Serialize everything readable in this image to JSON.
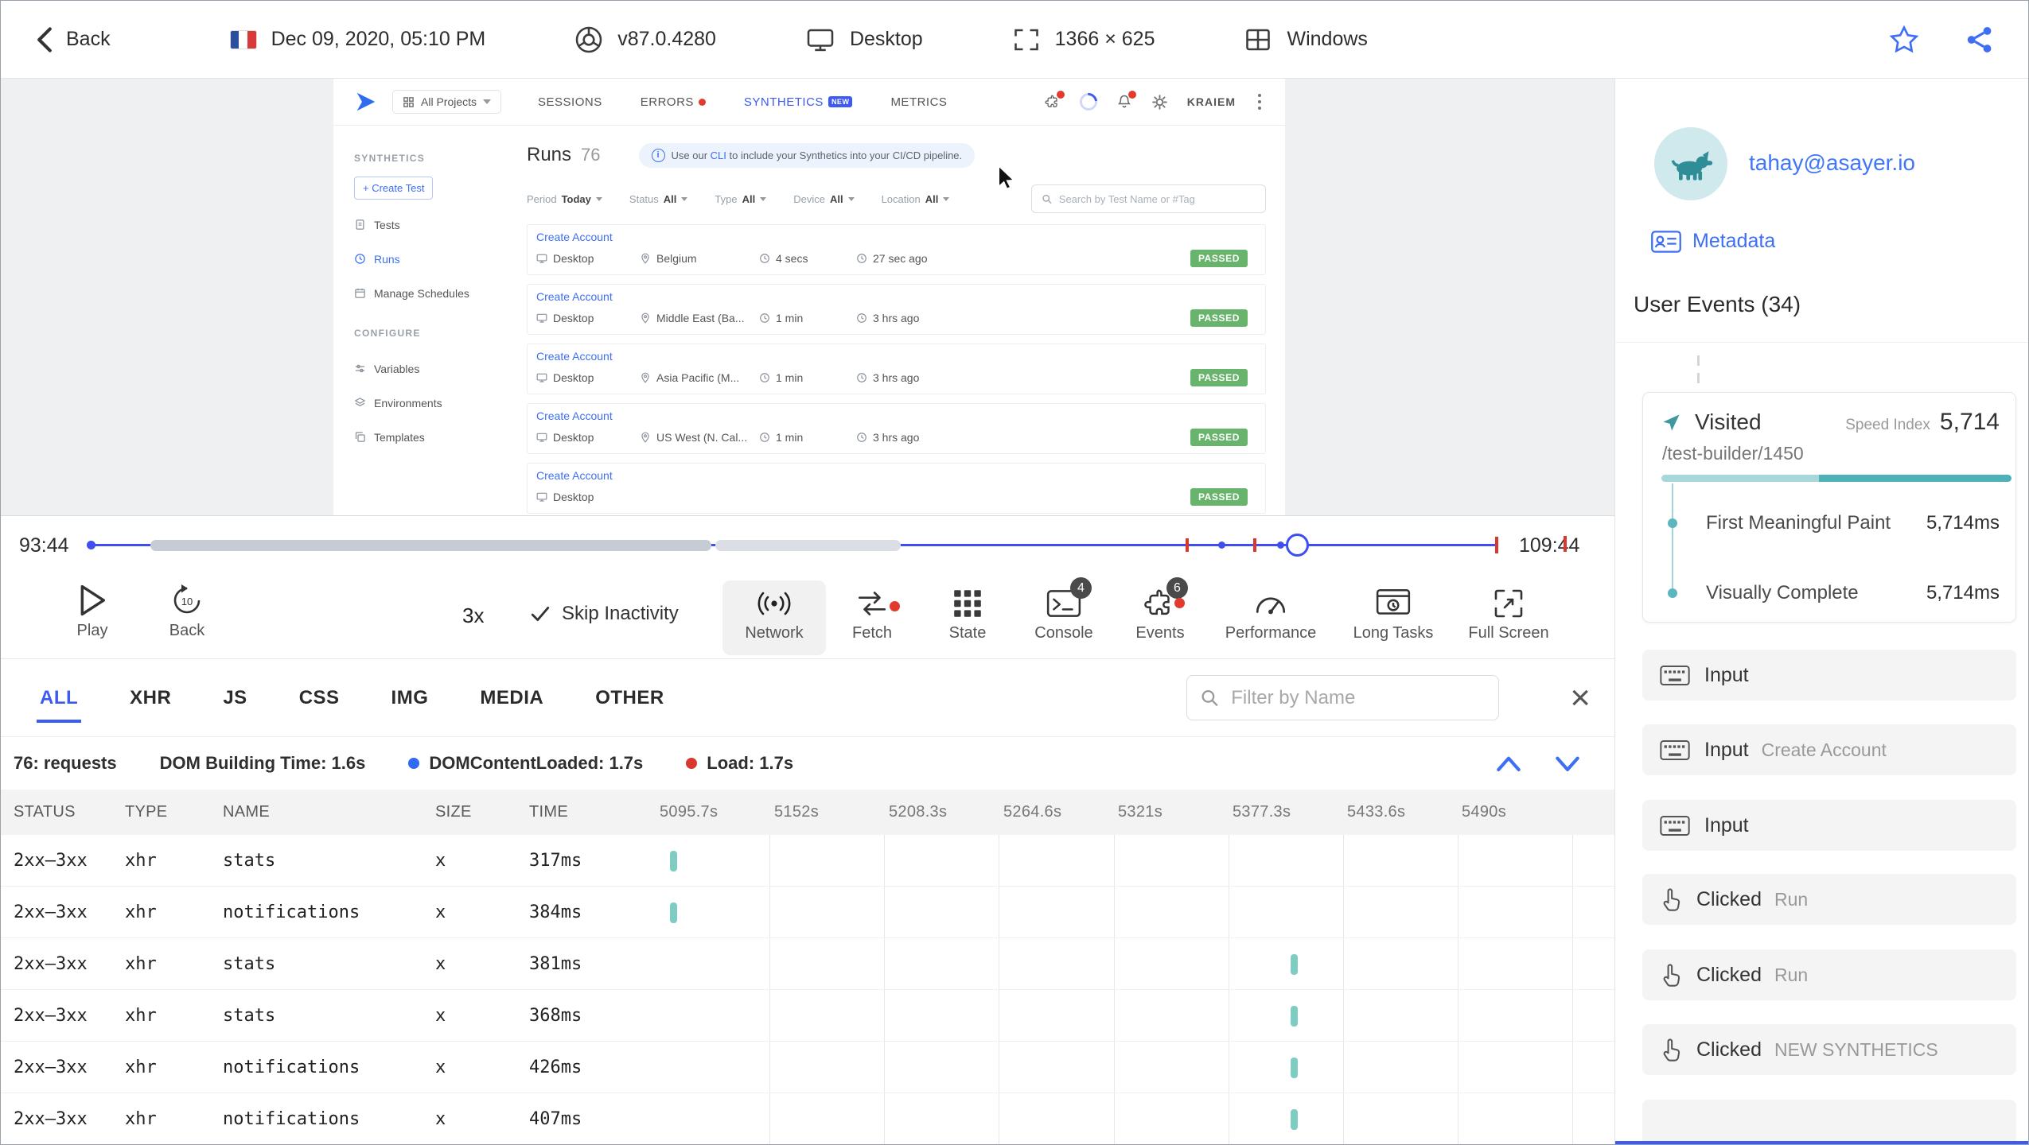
{
  "colors": {
    "accent_blue": "#3d5af1",
    "link_blue": "#3f6df6",
    "teal": "#3fa9ae",
    "passed_green": "#68b46c",
    "error_red": "#e23b2e"
  },
  "header": {
    "back_label": "Back",
    "date": "Dec 09, 2020, 05:10 PM",
    "browser_version": "v87.0.4280",
    "device": "Desktop",
    "resolution": "1366 × 625",
    "os": "Windows"
  },
  "replay": {
    "app": {
      "nav": {
        "project_selector": "All Projects",
        "tabs": [
          "SESSIONS",
          "ERRORS",
          "SYNTHETICS",
          "METRICS"
        ],
        "new_badge": "NEW",
        "user": "KRAIEM"
      },
      "sidebar": {
        "section1": "SYNTHETICS",
        "create_test": "+ Create Test",
        "items": [
          "Tests",
          "Runs",
          "Manage Schedules"
        ],
        "section2": "CONFIGURE",
        "config_items": [
          "Variables",
          "Environments",
          "Templates"
        ]
      },
      "main": {
        "title": "Runs",
        "count": "76",
        "banner_pre": "Use our ",
        "banner_link": "CLI",
        "banner_post": " to include your Synthetics into your CI/CD pipeline.",
        "filters": [
          {
            "label": "Period",
            "value": "Today"
          },
          {
            "label": "Status",
            "value": "All"
          },
          {
            "label": "Type",
            "value": "All"
          },
          {
            "label": "Device",
            "value": "All"
          },
          {
            "label": "Location",
            "value": "All"
          }
        ],
        "search_placeholder": "Search by Test Name or #Tag",
        "runs": [
          {
            "name": "Create Account",
            "device": "Desktop",
            "location": "Belgium",
            "duration": "4 secs",
            "ago": "27 sec ago",
            "status": "PASSED"
          },
          {
            "name": "Create Account",
            "device": "Desktop",
            "location": "Middle East (Ba...",
            "duration": "1 min",
            "ago": "3 hrs ago",
            "status": "PASSED"
          },
          {
            "name": "Create Account",
            "device": "Desktop",
            "location": "Asia Pacific (M...",
            "duration": "1 min",
            "ago": "3 hrs ago",
            "status": "PASSED"
          },
          {
            "name": "Create Account",
            "device": "Desktop",
            "location": "US West (N. Cal...",
            "duration": "1 min",
            "ago": "3 hrs ago",
            "status": "PASSED"
          },
          {
            "name": "Create Account",
            "device": "Desktop",
            "location": "",
            "duration": "",
            "ago": "",
            "status": "PASSED"
          }
        ]
      }
    }
  },
  "timeline": {
    "current_time": "93:44",
    "total_time": "109:44"
  },
  "controls": {
    "play_label": "Play",
    "back_label": "Back",
    "speed": "3x",
    "skip_label": "Skip Inactivity",
    "buttons": [
      {
        "label": "Network"
      },
      {
        "label": "Fetch"
      },
      {
        "label": "State"
      },
      {
        "label": "Console",
        "badge": "4"
      },
      {
        "label": "Events",
        "badge": "6"
      },
      {
        "label": "Performance"
      },
      {
        "label": "Long Tasks"
      },
      {
        "label": "Full Screen"
      }
    ]
  },
  "network_panel": {
    "tabs": [
      "ALL",
      "XHR",
      "JS",
      "CSS",
      "IMG",
      "MEDIA",
      "OTHER"
    ],
    "filter_placeholder": "Filter by Name",
    "summary": {
      "requests": "76: requests",
      "dom_building": "DOM Building Time: 1.6s",
      "dom_content_loaded": "DOMContentLoaded: 1.7s",
      "load": "Load: 1.7s"
    },
    "columns": [
      "STATUS",
      "TYPE",
      "NAME",
      "SIZE",
      "TIME"
    ],
    "time_columns": [
      "5095.7s",
      "5152s",
      "5208.3s",
      "5264.6s",
      "5321s",
      "5377.3s",
      "5433.6s",
      "5490s"
    ],
    "rows": [
      {
        "status": "2xx–3xx",
        "type": "xhr",
        "name": "stats",
        "size": "x",
        "time": "317ms",
        "marker_col": 0
      },
      {
        "status": "2xx–3xx",
        "type": "xhr",
        "name": "notifications",
        "size": "x",
        "time": "384ms",
        "marker_col": 0
      },
      {
        "status": "2xx–3xx",
        "type": "xhr",
        "name": "stats",
        "size": "x",
        "time": "381ms",
        "marker_col": 5
      },
      {
        "status": "2xx–3xx",
        "type": "xhr",
        "name": "stats",
        "size": "x",
        "time": "368ms",
        "marker_col": 5
      },
      {
        "status": "2xx–3xx",
        "type": "xhr",
        "name": "notifications",
        "size": "x",
        "time": "426ms",
        "marker_col": 5
      },
      {
        "status": "2xx–3xx",
        "type": "xhr",
        "name": "notifications",
        "size": "x",
        "time": "407ms",
        "marker_col": 5
      }
    ]
  },
  "user_panel": {
    "email": "tahay@asayer.io",
    "metadata_label": "Metadata",
    "events_title": "User Events (34)",
    "visited_card": {
      "label": "Visited",
      "speed_index_label": "Speed Index",
      "speed_index": "5,714",
      "path": "/test-builder/1450",
      "metrics": [
        {
          "name": "First Meaningful Paint",
          "value": "5,714ms"
        },
        {
          "name": "Visually Complete",
          "value": "5,714ms"
        }
      ]
    },
    "events": [
      {
        "type": "Input",
        "detail": ""
      },
      {
        "type": "Input",
        "detail": "Create Account"
      },
      {
        "type": "Input",
        "detail": ""
      },
      {
        "type": "Clicked",
        "detail": "Run"
      },
      {
        "type": "Clicked",
        "detail": "Run"
      },
      {
        "type": "Clicked",
        "detail": "NEW SYNTHETICS"
      }
    ]
  }
}
